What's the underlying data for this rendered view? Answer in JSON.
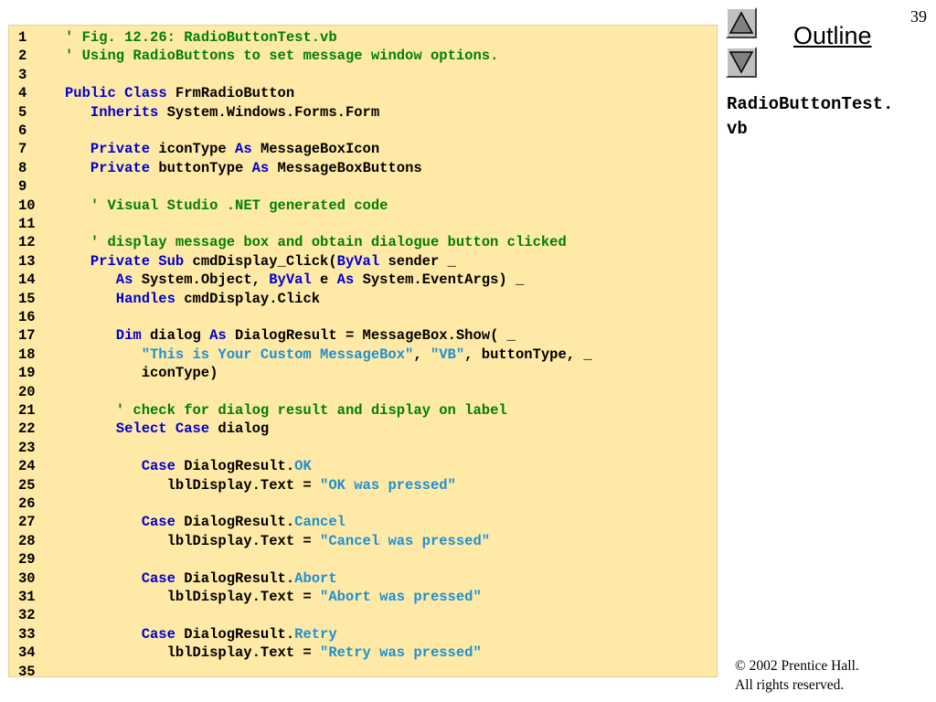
{
  "slide": {
    "number": "39",
    "outline_label": "Outline",
    "file_title_lines": [
      "RadioButtonTest.",
      "vb"
    ],
    "copyright_lines": [
      "© 2002 Prentice Hall.",
      "All rights reserved."
    ]
  },
  "colors": {
    "panel_bg": "#ffe9a7",
    "comment": "#008000",
    "keyword": "#0000cc",
    "string": "#1e90d0"
  },
  "icons": {
    "nav_up": "triangle-up-icon",
    "nav_down": "triangle-down-icon"
  },
  "code": [
    {
      "n": "1",
      "indent": 0,
      "tokens": [
        {
          "t": "' Fig. 12.26: RadioButtonTest.vb",
          "c": "comment"
        }
      ]
    },
    {
      "n": "2",
      "indent": 0,
      "tokens": [
        {
          "t": "' Using RadioButtons to set message window options.",
          "c": "comment"
        }
      ]
    },
    {
      "n": "3",
      "indent": 0,
      "tokens": []
    },
    {
      "n": "4",
      "indent": 0,
      "tokens": [
        {
          "t": "Public Class",
          "c": "keyword"
        },
        {
          "t": " FrmRadioButton",
          "c": "plain"
        }
      ]
    },
    {
      "n": "5",
      "indent": 3,
      "tokens": [
        {
          "t": "Inherits",
          "c": "keyword"
        },
        {
          "t": " System.Windows.Forms.Form",
          "c": "plain"
        }
      ]
    },
    {
      "n": "6",
      "indent": 0,
      "tokens": []
    },
    {
      "n": "7",
      "indent": 3,
      "tokens": [
        {
          "t": "Private",
          "c": "keyword"
        },
        {
          "t": " iconType ",
          "c": "plain"
        },
        {
          "t": "As",
          "c": "keyword"
        },
        {
          "t": " MessageBoxIcon",
          "c": "plain"
        }
      ]
    },
    {
      "n": "8",
      "indent": 3,
      "tokens": [
        {
          "t": "Private",
          "c": "keyword"
        },
        {
          "t": " buttonType ",
          "c": "plain"
        },
        {
          "t": "As",
          "c": "keyword"
        },
        {
          "t": " MessageBoxButtons",
          "c": "plain"
        }
      ]
    },
    {
      "n": "9",
      "indent": 0,
      "tokens": []
    },
    {
      "n": "10",
      "indent": 3,
      "tokens": [
        {
          "t": "' Visual Studio .NET generated code",
          "c": "comment"
        }
      ]
    },
    {
      "n": "11",
      "indent": 0,
      "tokens": []
    },
    {
      "n": "12",
      "indent": 3,
      "tokens": [
        {
          "t": "' display message box and obtain dialogue button clicked",
          "c": "comment"
        }
      ]
    },
    {
      "n": "13",
      "indent": 3,
      "tokens": [
        {
          "t": "Private Sub",
          "c": "keyword"
        },
        {
          "t": " cmdDisplay_Click(",
          "c": "plain"
        },
        {
          "t": "ByVal",
          "c": "keyword"
        },
        {
          "t": " sender _",
          "c": "plain"
        }
      ]
    },
    {
      "n": "14",
      "indent": 6,
      "tokens": [
        {
          "t": "As",
          "c": "keyword"
        },
        {
          "t": " System.Object, ",
          "c": "plain"
        },
        {
          "t": "ByVal",
          "c": "keyword"
        },
        {
          "t": " e ",
          "c": "plain"
        },
        {
          "t": "As",
          "c": "keyword"
        },
        {
          "t": " System.EventArgs) _",
          "c": "plain"
        }
      ]
    },
    {
      "n": "15",
      "indent": 6,
      "tokens": [
        {
          "t": "Handles",
          "c": "keyword"
        },
        {
          "t": " cmdDisplay.Click",
          "c": "plain"
        }
      ]
    },
    {
      "n": "16",
      "indent": 0,
      "tokens": []
    },
    {
      "n": "17",
      "indent": 6,
      "tokens": [
        {
          "t": "Dim",
          "c": "keyword"
        },
        {
          "t": " dialog ",
          "c": "plain"
        },
        {
          "t": "As",
          "c": "keyword"
        },
        {
          "t": " DialogResult = MessageBox.Show( _",
          "c": "plain"
        }
      ]
    },
    {
      "n": "18",
      "indent": 9,
      "tokens": [
        {
          "t": "\"This is Your Custom MessageBox\"",
          "c": "string"
        },
        {
          "t": ", ",
          "c": "plain"
        },
        {
          "t": "\"VB\"",
          "c": "string"
        },
        {
          "t": ", buttonType, _",
          "c": "plain"
        }
      ]
    },
    {
      "n": "19",
      "indent": 9,
      "tokens": [
        {
          "t": "iconType)",
          "c": "plain"
        }
      ]
    },
    {
      "n": "20",
      "indent": 0,
      "tokens": []
    },
    {
      "n": "21",
      "indent": 6,
      "tokens": [
        {
          "t": "' check for dialog result and display on label",
          "c": "comment"
        }
      ]
    },
    {
      "n": "22",
      "indent": 6,
      "tokens": [
        {
          "t": "Select Case",
          "c": "keyword"
        },
        {
          "t": " dialog",
          "c": "plain"
        }
      ]
    },
    {
      "n": "23",
      "indent": 0,
      "tokens": []
    },
    {
      "n": "24",
      "indent": 9,
      "tokens": [
        {
          "t": "Case",
          "c": "keyword"
        },
        {
          "t": " DialogResult.",
          "c": "plain"
        },
        {
          "t": "OK",
          "c": "member"
        }
      ]
    },
    {
      "n": "25",
      "indent": 12,
      "tokens": [
        {
          "t": "lblDisplay.Text = ",
          "c": "plain"
        },
        {
          "t": "\"OK was pressed\"",
          "c": "string"
        }
      ]
    },
    {
      "n": "26",
      "indent": 0,
      "tokens": []
    },
    {
      "n": "27",
      "indent": 9,
      "tokens": [
        {
          "t": "Case",
          "c": "keyword"
        },
        {
          "t": " DialogResult.",
          "c": "plain"
        },
        {
          "t": "Cancel",
          "c": "member"
        }
      ]
    },
    {
      "n": "28",
      "indent": 12,
      "tokens": [
        {
          "t": "lblDisplay.Text = ",
          "c": "plain"
        },
        {
          "t": "\"Cancel was pressed\"",
          "c": "string"
        }
      ]
    },
    {
      "n": "29",
      "indent": 0,
      "tokens": []
    },
    {
      "n": "30",
      "indent": 9,
      "tokens": [
        {
          "t": "Case",
          "c": "keyword"
        },
        {
          "t": " DialogResult.",
          "c": "plain"
        },
        {
          "t": "Abort",
          "c": "member"
        }
      ]
    },
    {
      "n": "31",
      "indent": 12,
      "tokens": [
        {
          "t": "lblDisplay.Text = ",
          "c": "plain"
        },
        {
          "t": "\"Abort was pressed\"",
          "c": "string"
        }
      ]
    },
    {
      "n": "32",
      "indent": 0,
      "tokens": []
    },
    {
      "n": "33",
      "indent": 9,
      "tokens": [
        {
          "t": "Case",
          "c": "keyword"
        },
        {
          "t": " DialogResult.",
          "c": "plain"
        },
        {
          "t": "Retry",
          "c": "member"
        }
      ]
    },
    {
      "n": "34",
      "indent": 12,
      "tokens": [
        {
          "t": "lblDisplay.Text = ",
          "c": "plain"
        },
        {
          "t": "\"Retry was pressed\"",
          "c": "string"
        }
      ]
    },
    {
      "n": "35",
      "indent": 0,
      "tokens": []
    }
  ]
}
